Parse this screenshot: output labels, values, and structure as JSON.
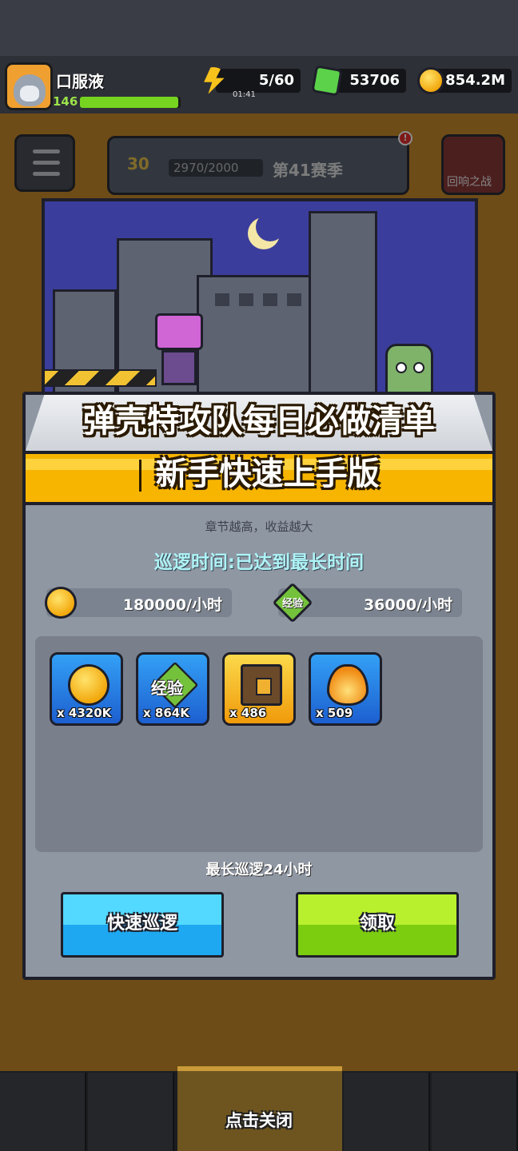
{
  "player": {
    "name": "口服液",
    "level": "146",
    "xp_fraction": 0.98
  },
  "resources": {
    "energy": "5/60",
    "energy_timer": "01:41",
    "gems": "53706",
    "gold": "854.2M"
  },
  "season": {
    "level": "30",
    "progress": "2970/2000",
    "label": "第41赛季"
  },
  "side": {
    "battle_label": "回响之战"
  },
  "overlay": {
    "title_line1": "弹壳特攻队每日必做清单",
    "title_line2": "新手快速上手版"
  },
  "patrol": {
    "hint": "章节越高，收益越大",
    "time_status": "巡逻时间:已达到最长时间",
    "gold_rate": "180000/小时",
    "exp_label": "经验",
    "exp_rate": "36000/小时",
    "rewards": [
      {
        "icon": "gold-coin-icon",
        "count": "x 4320K"
      },
      {
        "icon": "exp-icon",
        "label": "经验",
        "count": "x 864K"
      },
      {
        "icon": "chest-icon",
        "count": "x 486"
      },
      {
        "icon": "flame-icon",
        "count": "x 509"
      }
    ],
    "max_duration": "最长巡逻24小时",
    "quick_patrol_label": "快速巡逻",
    "claim_label": "领取"
  },
  "footer": {
    "close_hint": "点击关闭"
  },
  "colors": {
    "accent_yellow": "#f7b500",
    "button_blue": "#1ea8f1",
    "button_green": "#7ccc10",
    "patrol_text": "#aef3f6"
  }
}
